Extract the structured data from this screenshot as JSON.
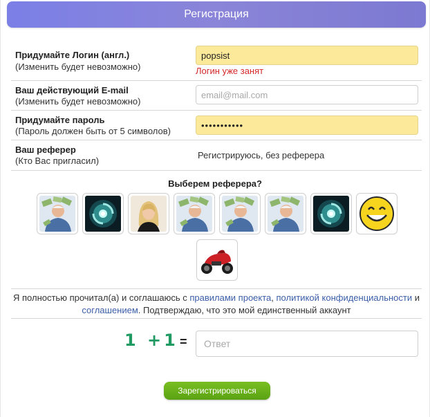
{
  "header": {
    "title": "Регистрация"
  },
  "form": {
    "login": {
      "label": "Придумайте Логин (англ.)",
      "sub": "(Изменить будет невозможно)",
      "value": "popsist",
      "error": "Логин уже занят"
    },
    "email": {
      "label": "Ваш действующий E-mail",
      "sub": "(Изменить будет невозможно)",
      "placeholder": "email@mail.com"
    },
    "password": {
      "label": "Придумайте пароль",
      "sub": "(Пароль должен быть от 5 символов)",
      "value": "•••••••••••"
    },
    "referrer": {
      "label": "Ваш реферер",
      "sub": "(Кто Вас пригласил)",
      "value": "Регистрируюсь, без реферера"
    }
  },
  "choose": {
    "title": "Выберем реферера?",
    "avatars": [
      "money-man",
      "swirl",
      "blonde-woman",
      "money-man",
      "money-man",
      "money-man",
      "swirl",
      "smiley",
      "motorcycle"
    ]
  },
  "agreement": {
    "text_1": "Я полностью прочитал(а) и соглашаюсь с ",
    "link_rules": "правилами проекта",
    "text_2": ", ",
    "link_privacy": "политикой конфиденциальности",
    "text_3": " и ",
    "link_terms": "соглашением",
    "text_4": ". Подтверждаю, что это мой единственный аккаунт"
  },
  "captcha": {
    "question": "1 +1",
    "equals": "=",
    "placeholder": "Ответ"
  },
  "submit_label": "Зарегистрироваться",
  "colors": {
    "header": "#7b7fe6",
    "input_highlight": "#fde99a",
    "error": "#d4282a",
    "link": "#3b5ea8",
    "captcha": "#1f9a62",
    "button": "#62a817"
  }
}
